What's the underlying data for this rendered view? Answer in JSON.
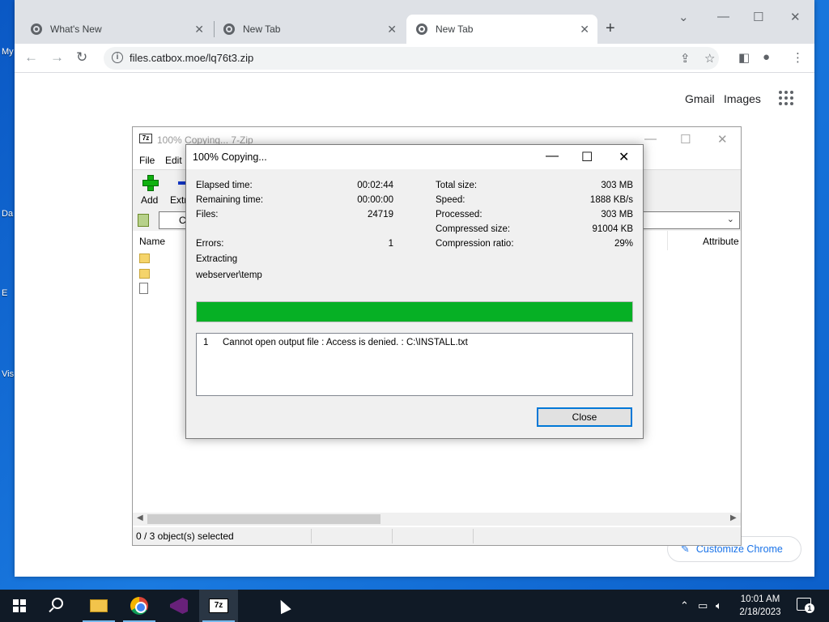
{
  "desktop": {
    "labels": [
      "My",
      "Da",
      "E",
      "Vis"
    ]
  },
  "chrome": {
    "tabs": [
      {
        "label": "What's New"
      },
      {
        "label": "New Tab"
      },
      {
        "label": "New Tab"
      }
    ],
    "url": "files.catbox.moe/lq76t3.zip",
    "links": {
      "gmail": "Gmail",
      "images": "Images"
    },
    "customize_label": "Customize Chrome"
  },
  "zip_main": {
    "title": "100% Copying... 7-Zip",
    "menu": [
      "File",
      "Edit"
    ],
    "tools": {
      "add": "Add",
      "extract": "Extr"
    },
    "path": "C",
    "columns": {
      "name": "Name",
      "attributes": "Attribute"
    },
    "status": "0 / 3 object(s) selected"
  },
  "dialog": {
    "title": "100% Copying...",
    "left_stats": [
      {
        "label": "Elapsed time:",
        "value": "00:02:44"
      },
      {
        "label": "Remaining time:",
        "value": "00:00:00"
      },
      {
        "label": "Files:",
        "value": "24719"
      },
      {
        "label": "Errors:",
        "value": "1"
      }
    ],
    "right_stats": [
      {
        "label": "Total size:",
        "value": "303 MB"
      },
      {
        "label": "Speed:",
        "value": "1888 KB/s"
      },
      {
        "label": "Processed:",
        "value": "303 MB"
      },
      {
        "label": "Compressed size:",
        "value": "91004 KB"
      },
      {
        "label": "Compression ratio:",
        "value": "29%"
      }
    ],
    "operation": "Extracting",
    "current_path": "webserver\\temp",
    "progress_percent": 100,
    "errors": [
      {
        "num": "1",
        "message": "Cannot open output file : Access is denied. : C:\\INSTALL.txt"
      }
    ],
    "close_label": "Close"
  },
  "taskbar": {
    "zip_label": "7z",
    "time": "10:01 AM",
    "date": "2/18/2023",
    "notification_count": "1"
  },
  "colors": {
    "progress": "#06b025",
    "accent": "#0078d7",
    "link": "#1a73e8"
  }
}
